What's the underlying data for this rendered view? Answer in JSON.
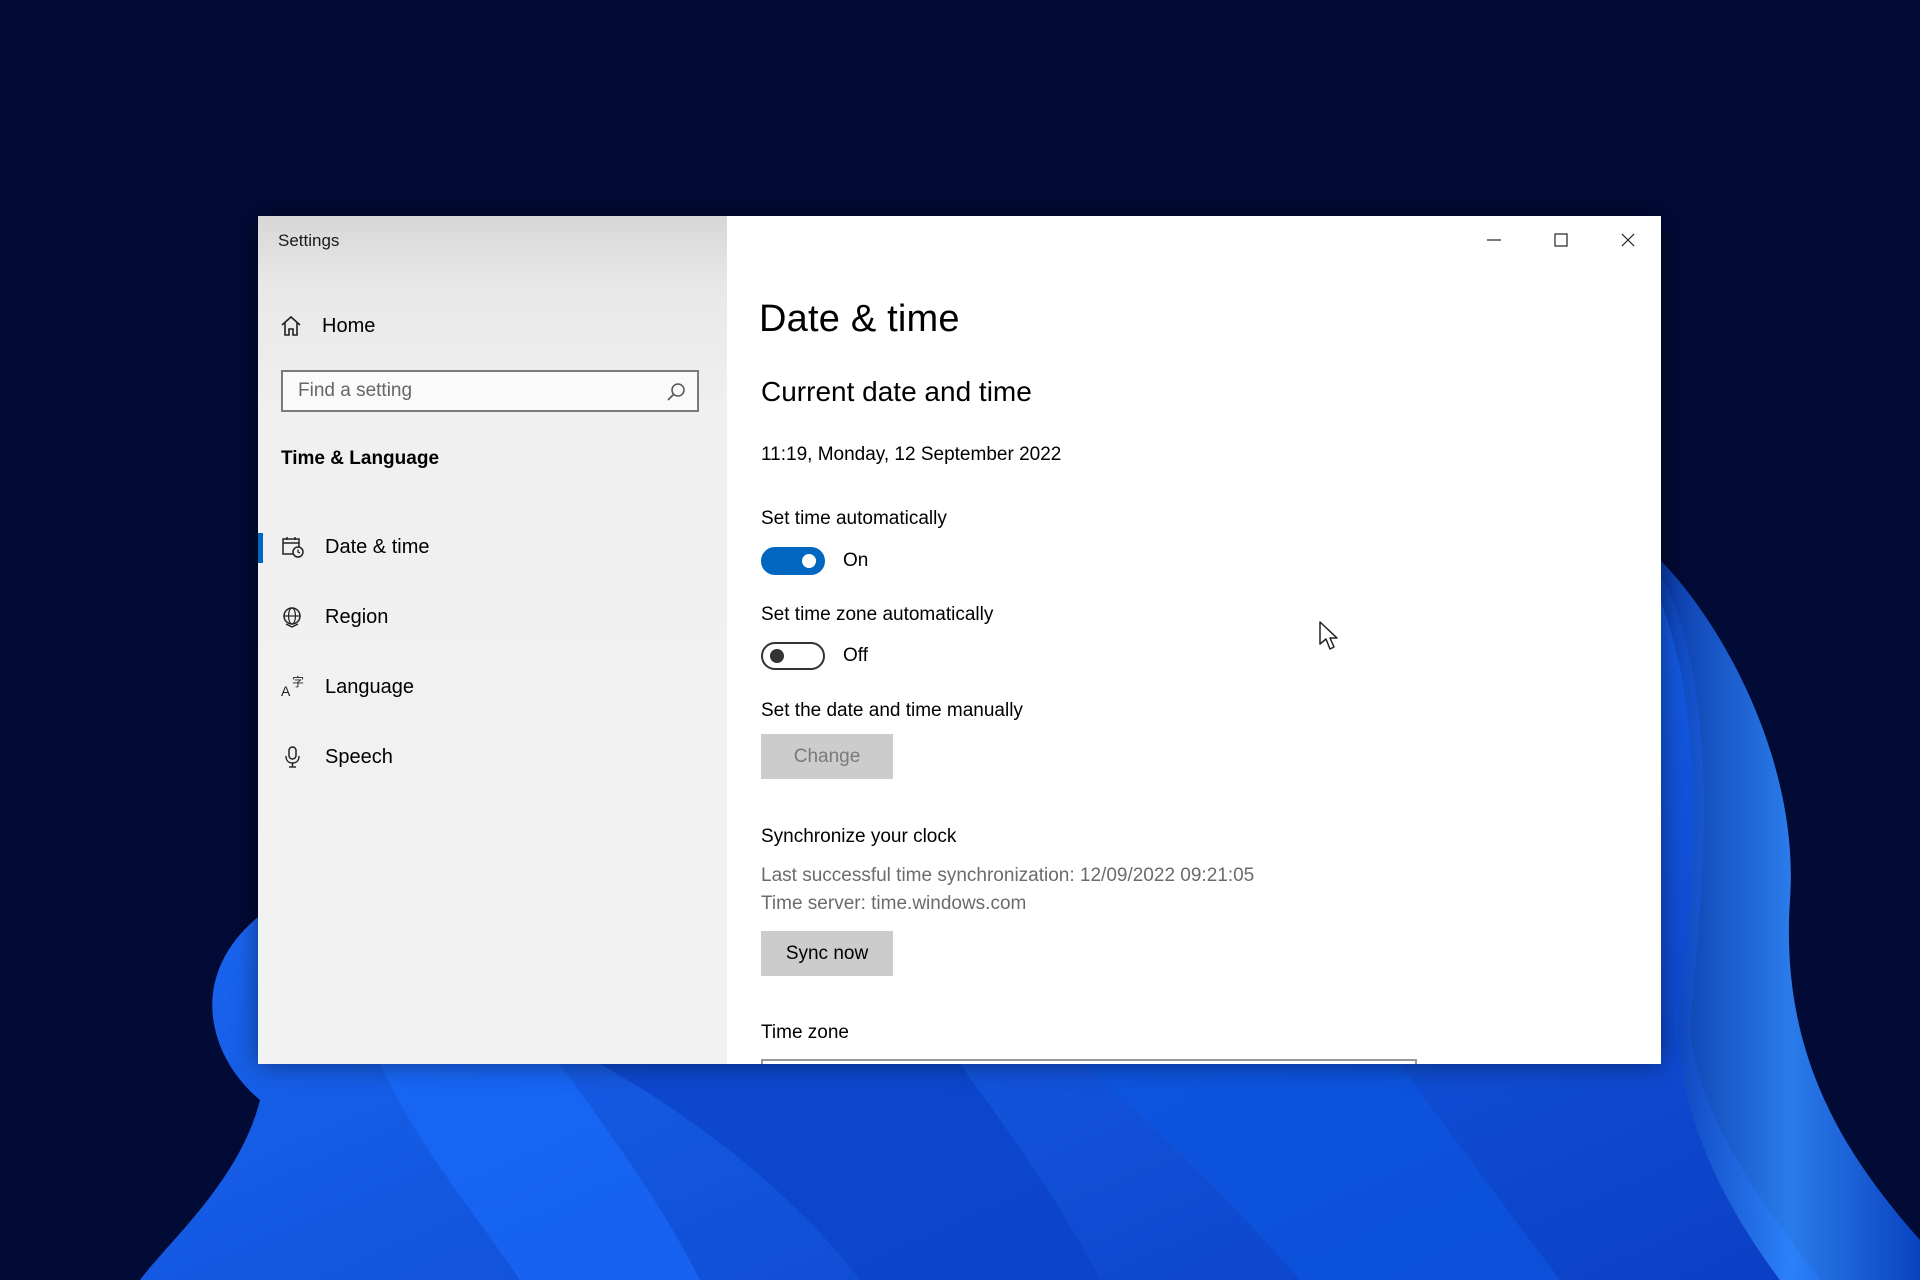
{
  "window": {
    "app_title": "Settings",
    "controls": [
      "minimize",
      "maximize",
      "close"
    ]
  },
  "sidebar": {
    "home_label": "Home",
    "search_placeholder": "Find a setting",
    "section_title": "Time & Language",
    "items": [
      {
        "label": "Date & time",
        "icon": "calendar-clock-icon",
        "active": true
      },
      {
        "label": "Region",
        "icon": "globe-icon",
        "active": false
      },
      {
        "label": "Language",
        "icon": "language-icon",
        "active": false
      },
      {
        "label": "Speech",
        "icon": "microphone-icon",
        "active": false
      }
    ]
  },
  "main": {
    "page_title": "Date & time",
    "subtitle": "Current date and time",
    "current_datetime": "11:19, Monday, 12 September 2022",
    "set_time_auto": {
      "label": "Set time automatically",
      "state": "On"
    },
    "set_tz_auto": {
      "label": "Set time zone automatically",
      "state": "Off"
    },
    "manual": {
      "label": "Set the date and time manually",
      "button": "Change"
    },
    "sync": {
      "label": "Synchronize your clock",
      "last_sync": "Last successful time synchronization: 12/09/2022 09:21:05",
      "server": "Time server: time.windows.com",
      "button": "Sync now"
    },
    "time_zone_label": "Time zone"
  },
  "colors": {
    "accent": "#0067c0",
    "desktop": "#020a36",
    "sidebar": "#f2f2f2"
  }
}
